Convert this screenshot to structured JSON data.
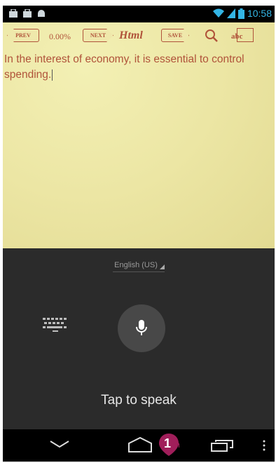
{
  "status_bar": {
    "time": "10:58"
  },
  "toolbar": {
    "prev_label": "PREV",
    "progress": "0.00%",
    "next_label": "NEXT",
    "format_label": "Html",
    "save_label": "SAVE",
    "abc_label": "abc"
  },
  "note": {
    "text": "In the interest of economy, it is essential to control spending."
  },
  "voice_input": {
    "language": "English (US)",
    "prompt": "Tap to speak"
  },
  "callout": {
    "number": "1",
    "color": "#a01e5a"
  },
  "colors": {
    "note_text": "#b0533a",
    "status_accent": "#33b5e5",
    "panel_bg": "#2b2b2b"
  }
}
